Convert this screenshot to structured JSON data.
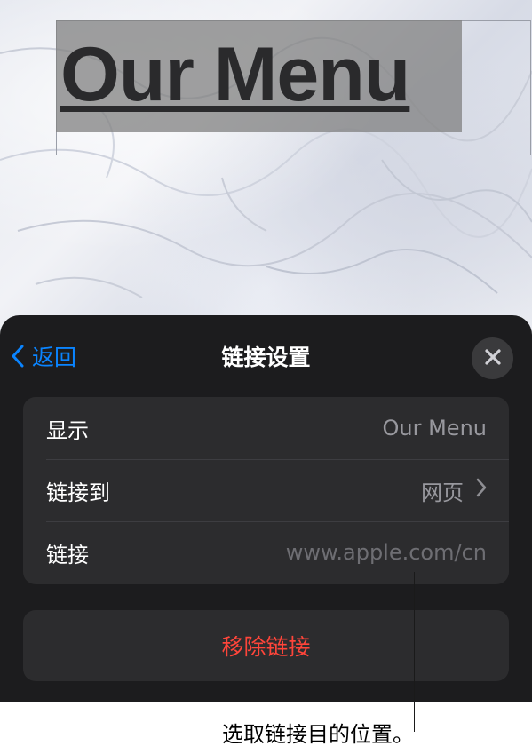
{
  "canvas": {
    "title_text": "Our Menu"
  },
  "sheet": {
    "back_label": "返回",
    "title": "链接设置",
    "rows": [
      {
        "label": "显示",
        "value": "Our Menu"
      },
      {
        "label": "链接到",
        "value": "网页"
      },
      {
        "label": "链接",
        "value": "www.apple.com/cn"
      }
    ],
    "remove_label": "移除链接"
  },
  "callout": {
    "text": "选取链接目的位置。"
  },
  "colors": {
    "accent": "#0a84ff",
    "destructive": "#ff453a",
    "sheet_bg": "#1c1c1e",
    "group_bg": "#2c2c2e"
  },
  "icons": {
    "back": "chevron-left-icon",
    "close": "close-icon",
    "disclosure": "chevron-right-icon"
  }
}
